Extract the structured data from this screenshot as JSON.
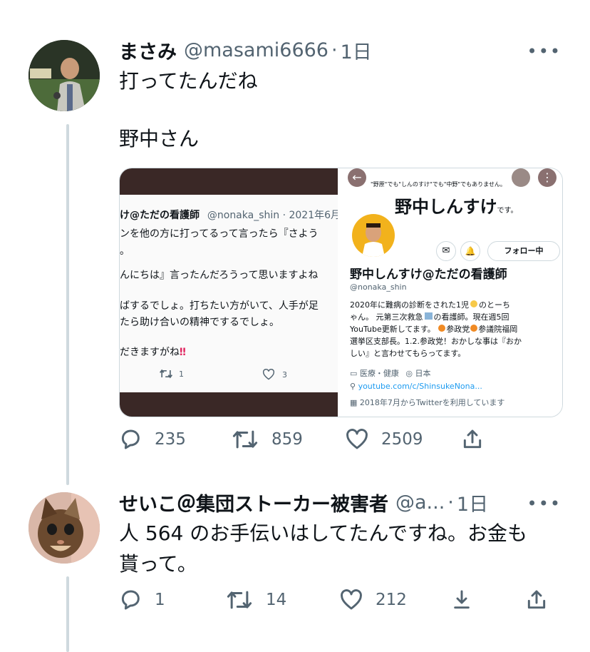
{
  "tweet1": {
    "name": "まさみ",
    "handle": "@masami6666",
    "time": "1日",
    "more": "•••",
    "line1": "打ってたんだね",
    "line2": "野中さん",
    "card": {
      "left": {
        "header": "け@ただの看護師",
        "header_meta": "@nonaka_shin · 2021年6月",
        "lines": [
          "ンを他の方に打ってるって言ったら『さよう",
          "。",
          "んにちは』言ったんだろうって思いますよね",
          "ばするでしょ。打ちたい方がいて、人手が足",
          "たら助け合いの精神でするでしょ。",
          "だきますがね",
          "‼"
        ],
        "retweets": "1",
        "likes": "3"
      },
      "right": {
        "banner_caption": "\"野原\"でも\"しんのすけ\"でも\"中野\"でもありません。",
        "banner_title": "野中しんすけ",
        "banner_desu": "です。",
        "follow_label": "フォロー中",
        "display_name": "野中しんすけ@ただの看護師",
        "handle": "@nonaka_shin",
        "bio1": "2020年に難病の診断をされた1児",
        "bio1b": "のとーち",
        "bio2": "ゃん。 元第三次救急",
        "bio2b": "の看護師。現在週5回",
        "bio3": "YouTube更新してます。",
        "bio3b": "参政党",
        "bio3c": "参議院福岡",
        "bio4": "選挙区支部長。1.2.参政党！おかしな事は『おか",
        "bio5": "しい』と言わせてもらってます。",
        "category": "医療・健康",
        "location": "日本",
        "link": "youtube.com/c/ShinsukeNona...",
        "joined": "2018年7月からTwitterを利用しています"
      }
    },
    "reply_count": "235",
    "retweet_count": "859",
    "like_count": "2509"
  },
  "tweet2": {
    "name": "せいこ＠集団ストーカー被害者",
    "handle": "@a...",
    "time": "1日",
    "more": "•••",
    "line1": "人 564 のお手伝いはしてたんですね。お金も",
    "line2": "貰って。",
    "reply_count": "1",
    "retweet_count": "14",
    "like_count": "212"
  },
  "colors": {
    "secondary": "#536471",
    "thread_line": "#cfd9de",
    "dark_band": "#3a2826",
    "orange": "#f08a24",
    "link_gray": "#5b7083"
  }
}
